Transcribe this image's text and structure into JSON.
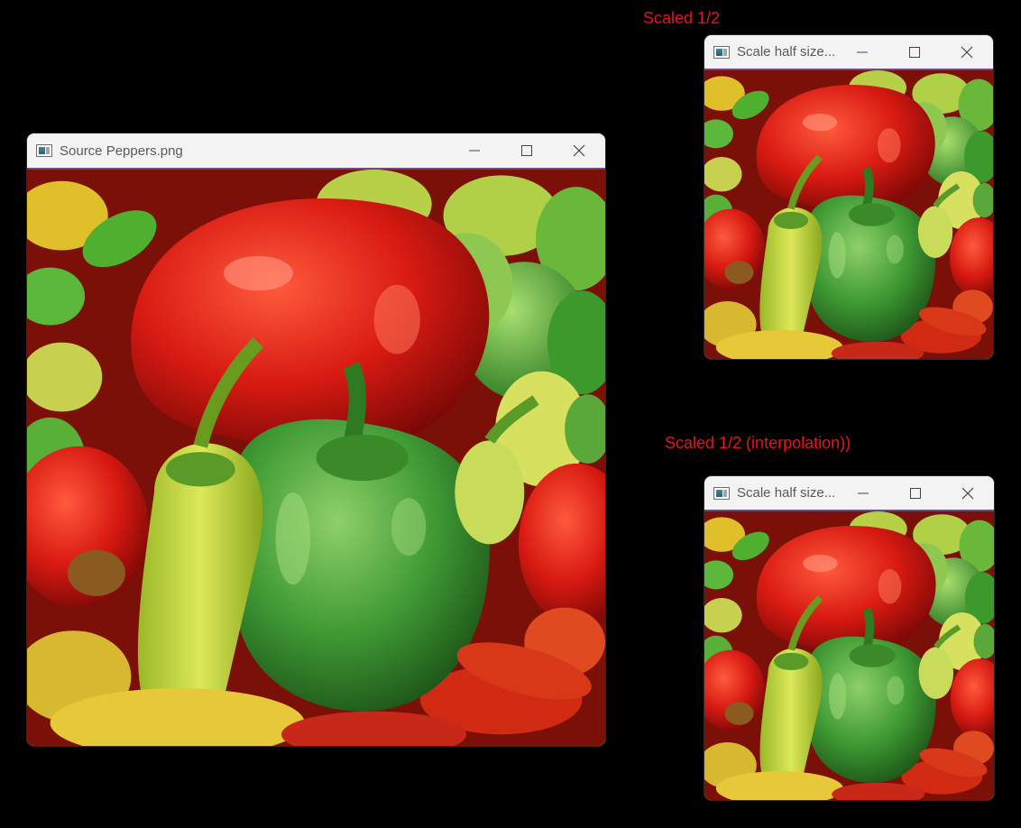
{
  "captions": {
    "scaled": "Scaled 1/2",
    "scaled_interp": "Scaled 1/2 (interpolation))"
  },
  "windows": {
    "source": {
      "title": "Source Peppers.png"
    },
    "half_1": {
      "title": "Scale half size..."
    },
    "half_2": {
      "title": "Scale half size..."
    }
  },
  "icons": {
    "app": "opencv-window-icon",
    "minimize": "minimize-icon",
    "maximize": "maximize-icon",
    "close": "close-icon"
  },
  "colors": {
    "background": "#000000",
    "caption": "#e8141c",
    "titlebar": "#f3f3f3",
    "accent_border": "#6b4a8a"
  },
  "image": {
    "subject": "peppers",
    "alt": "Peppers photo"
  }
}
